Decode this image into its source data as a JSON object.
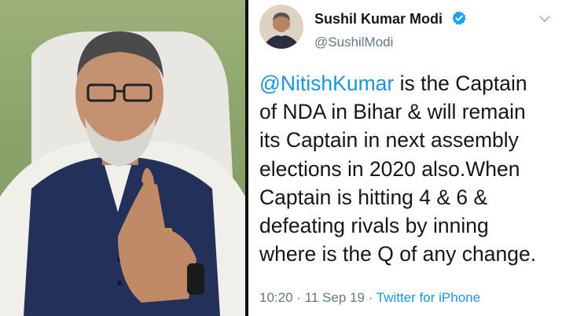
{
  "tweet": {
    "author_name": "Sushil Kumar Modi",
    "handle": "@SushilModi",
    "mention": "@NitishKumar",
    "lines": [
      " is the Captain",
      "of NDA in Bihar & will remain",
      "its Captain in next assembly",
      "elections in 2020 also.When",
      "Captain is hitting 4 & 6 &",
      "defeating rivals by inning",
      "where is the Q of any change."
    ],
    "time": "10:20",
    "date": "11 Sep 19",
    "separator": "·",
    "source": "Twitter for iPhone",
    "verified_color": "#1da1f2",
    "mention_color": "#1b95e0"
  },
  "icons": {
    "verified": "verified-badge-icon",
    "menu": "chevron-down-icon"
  }
}
